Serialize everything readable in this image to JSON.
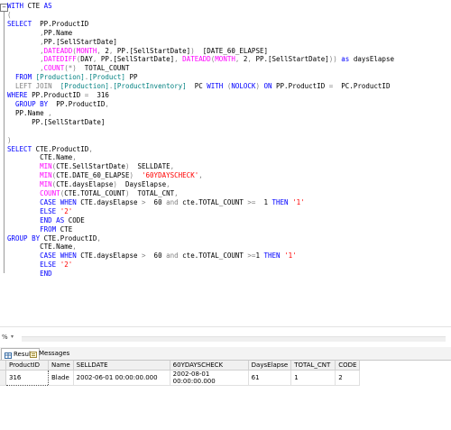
{
  "editor": {
    "lines": [
      [
        [
          "kw",
          "WITH "
        ],
        [
          "",
          "CTE "
        ],
        [
          "kw",
          "AS"
        ]
      ],
      [
        [
          "gr",
          "("
        ]
      ],
      [
        [
          "kw",
          "SELECT  "
        ],
        [
          "",
          "PP.ProductID"
        ]
      ],
      [
        [
          "",
          "        "
        ],
        [
          "gr",
          ","
        ],
        [
          "",
          "PP.Name"
        ]
      ],
      [
        [
          "",
          "        "
        ],
        [
          "gr",
          ","
        ],
        [
          "",
          "PP.[SellStartDate]"
        ]
      ],
      [
        [
          "",
          "        "
        ],
        [
          "gr",
          ","
        ],
        [
          "fn",
          "DATEADD"
        ],
        [
          "gr",
          "("
        ],
        [
          "fn",
          "MONTH"
        ],
        [
          "gr",
          ", "
        ],
        [
          "",
          "2"
        ],
        [
          "gr",
          ", "
        ],
        [
          "",
          "PP.[SellStartDate]"
        ],
        [
          "gr",
          ")"
        ],
        [
          "",
          "  [DATE_60_ELAPSE]"
        ]
      ],
      [
        [
          "",
          "        "
        ],
        [
          "gr",
          ","
        ],
        [
          "fn",
          "DATEDIFF"
        ],
        [
          "gr",
          "("
        ],
        [
          "",
          "DAY"
        ],
        [
          "gr",
          ", "
        ],
        [
          "",
          "PP.[SellStartDate]"
        ],
        [
          "gr",
          ", "
        ],
        [
          "fn",
          "DATEADD"
        ],
        [
          "gr",
          "("
        ],
        [
          "fn",
          "MONTH"
        ],
        [
          "gr",
          ", "
        ],
        [
          "",
          "2"
        ],
        [
          "gr",
          ", "
        ],
        [
          "",
          "PP.[SellStartDate]"
        ],
        [
          "gr",
          "))"
        ],
        [
          "kw",
          " as "
        ],
        [
          "",
          "daysElapse"
        ]
      ],
      [
        [
          "",
          "        "
        ],
        [
          "gr",
          ","
        ],
        [
          "fn",
          "COUNT"
        ],
        [
          "gr",
          "(*)"
        ],
        [
          "",
          "  TOTAL_COUNT"
        ]
      ],
      [
        [
          "kw",
          "  FROM "
        ],
        [
          "tl",
          "[Production]"
        ],
        [
          "gr",
          "."
        ],
        [
          "tl",
          "[Product]"
        ],
        [
          "",
          "",
          " "
        ],
        [
          "",
          "PP"
        ]
      ],
      [
        [
          "gr",
          "  LEFT JOIN  "
        ],
        [
          "tl",
          "[Production]"
        ],
        [
          "gr",
          "."
        ],
        [
          "tl",
          "[ProductInventory]"
        ],
        [
          "",
          "  PC "
        ],
        [
          "kw",
          "WITH "
        ],
        [
          "gr",
          "("
        ],
        [
          "kw",
          "NOLOCK"
        ],
        [
          "gr",
          ")"
        ],
        [
          "kw",
          " ON "
        ],
        [
          "",
          "PP.ProductID "
        ],
        [
          "gr",
          "="
        ],
        [
          "",
          "  PC.ProductID"
        ]
      ],
      [
        [
          "kw",
          "WHERE "
        ],
        [
          "",
          "PP.ProductID "
        ],
        [
          "gr",
          "="
        ],
        [
          "",
          "  316"
        ]
      ],
      [
        [
          "kw",
          "  GROUP BY  "
        ],
        [
          "",
          "PP.ProductID"
        ],
        [
          "gr",
          ","
        ]
      ],
      [
        [
          "",
          "  PP.Name "
        ],
        [
          "gr",
          ","
        ]
      ],
      [
        [
          "",
          "      PP.[SellStartDate]"
        ]
      ],
      [
        [
          "",
          ""
        ]
      ],
      [
        [
          "gr",
          ")"
        ]
      ],
      [
        [
          "kw",
          "SELECT "
        ],
        [
          "",
          "CTE.ProductID"
        ],
        [
          "gr",
          ","
        ]
      ],
      [
        [
          "",
          "        CTE.Name"
        ],
        [
          "gr",
          ","
        ]
      ],
      [
        [
          "",
          "        "
        ],
        [
          "fn",
          "MIN"
        ],
        [
          "gr",
          "("
        ],
        [
          "",
          "CTE.SellStartDate"
        ],
        [
          "gr",
          ")"
        ],
        [
          "",
          "  SELLDATE"
        ],
        [
          "gr",
          ","
        ]
      ],
      [
        [
          "",
          "        "
        ],
        [
          "fn",
          "MIN"
        ],
        [
          "gr",
          "("
        ],
        [
          "",
          "CTE.DATE_60_ELAPSE"
        ],
        [
          "gr",
          ")"
        ],
        [
          "str",
          "  '60YDAYSCHECK'"
        ],
        [
          "gr",
          ","
        ]
      ],
      [
        [
          "",
          "        "
        ],
        [
          "fn",
          "MIN"
        ],
        [
          "gr",
          "("
        ],
        [
          "",
          "CTE.daysElapse"
        ],
        [
          "gr",
          ")"
        ],
        [
          "",
          "  DaysElapse"
        ],
        [
          "gr",
          ","
        ]
      ],
      [
        [
          "",
          "        "
        ],
        [
          "fn",
          "COUNT"
        ],
        [
          "gr",
          "("
        ],
        [
          "",
          "CTE.TOTAL_COUNT"
        ],
        [
          "gr",
          ")"
        ],
        [
          "",
          "  TOTAL_CNT"
        ],
        [
          "gr",
          ","
        ]
      ],
      [
        [
          "",
          "        "
        ],
        [
          "kw",
          "CASE WHEN "
        ],
        [
          "",
          "CTE.daysElapse "
        ],
        [
          "gr",
          ">"
        ],
        [
          "",
          "  60 "
        ],
        [
          "gr",
          "and "
        ],
        [
          "",
          "cte.TOTAL_COUNT "
        ],
        [
          "gr",
          ">="
        ],
        [
          "",
          "  1 "
        ],
        [
          "kw",
          "THEN "
        ],
        [
          "str",
          "'1'"
        ]
      ],
      [
        [
          "",
          "        "
        ],
        [
          "kw",
          "ELSE "
        ],
        [
          "str",
          "'2'"
        ]
      ],
      [
        [
          "",
          "        "
        ],
        [
          "kw",
          "END AS "
        ],
        [
          "",
          "CODE"
        ]
      ],
      [
        [
          "",
          "        "
        ],
        [
          "kw",
          "FROM "
        ],
        [
          "",
          "CTE"
        ]
      ],
      [
        [
          "kw",
          "GROUP BY "
        ],
        [
          "",
          "CTE.ProductID"
        ],
        [
          "gr",
          ","
        ]
      ],
      [
        [
          "",
          "        CTE.Name"
        ],
        [
          "gr",
          ","
        ]
      ],
      [
        [
          "",
          "        "
        ],
        [
          "kw",
          "CASE WHEN "
        ],
        [
          "",
          "CTE.daysElapse "
        ],
        [
          "gr",
          ">"
        ],
        [
          "",
          "  60 "
        ],
        [
          "gr",
          "and "
        ],
        [
          "",
          "cte.TOTAL_COUNT "
        ],
        [
          "gr",
          ">="
        ],
        [
          "",
          "1 "
        ],
        [
          "kw",
          "THEN "
        ],
        [
          "str",
          "'1'"
        ]
      ],
      [
        [
          "",
          "        "
        ],
        [
          "kw",
          "ELSE "
        ],
        [
          "str",
          "'2'"
        ]
      ],
      [
        [
          "",
          "        "
        ],
        [
          "kw",
          "END"
        ]
      ]
    ]
  },
  "status": {
    "zoom": "%"
  },
  "results": {
    "tabs": [
      "Results",
      "Messages"
    ],
    "columns": [
      "ProductID",
      "Name",
      "SELLDATE",
      "60YDAYSCHECK",
      "DaysElapse",
      "TOTAL_CNT",
      "CODE"
    ],
    "rows": [
      [
        "316",
        "Blade",
        "2002-06-01 00:00:00.000",
        "2002-08-01 00:00:00.000",
        "61",
        "1",
        "2"
      ]
    ]
  }
}
